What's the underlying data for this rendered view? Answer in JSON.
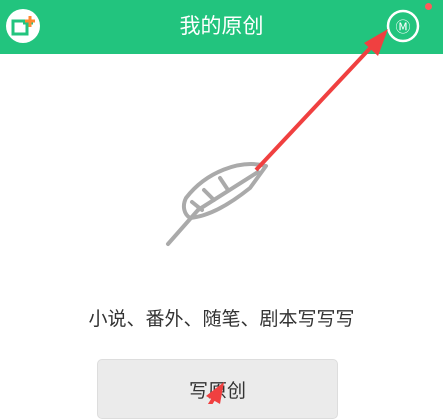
{
  "header": {
    "title": "我的原创",
    "left_icon": "add-work-icon",
    "right_icon": "badge-icon",
    "right_badge_text": "Ⓜ",
    "background_color": "#22c47e"
  },
  "main": {
    "illustration_icon": "feather-icon",
    "slogan": "小说、番外、随笔、剧本写写写",
    "write_button_label": "写原创"
  },
  "annotations": {
    "arrow_color": "#f04040"
  }
}
